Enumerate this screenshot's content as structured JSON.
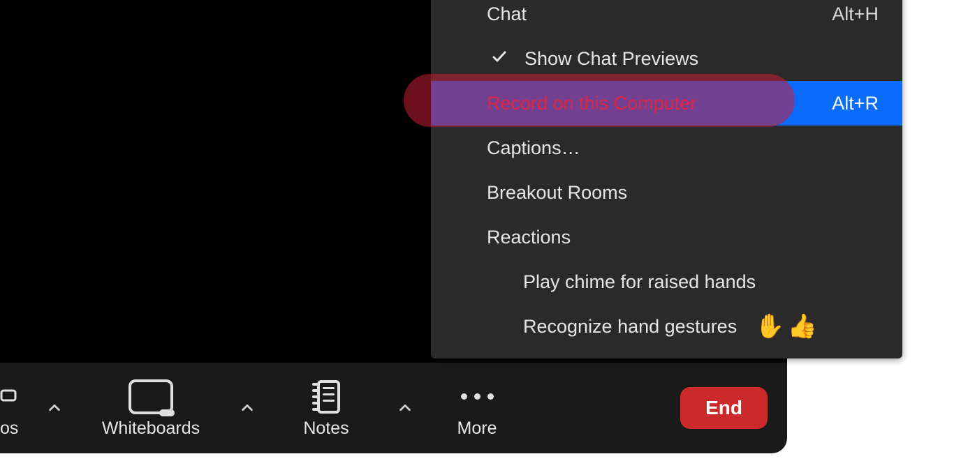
{
  "toolbar": {
    "partial_label": "os",
    "whiteboards_label": "Whiteboards",
    "notes_label": "Notes",
    "more_label": "More",
    "end_label": "End"
  },
  "menu": {
    "chat": {
      "label": "Chat",
      "shortcut": "Alt+H"
    },
    "show_chat_previews": {
      "label": "Show Chat Previews",
      "checked": true
    },
    "record": {
      "label": "Record on this Computer",
      "shortcut": "Alt+R"
    },
    "captions": {
      "label": "Captions…"
    },
    "breakout": {
      "label": "Breakout Rooms"
    },
    "reactions": {
      "label": "Reactions"
    },
    "chime": {
      "label": "Play chime for raised hands"
    },
    "gestures": {
      "label": "Recognize hand gestures",
      "emoji": "✋👍"
    }
  }
}
